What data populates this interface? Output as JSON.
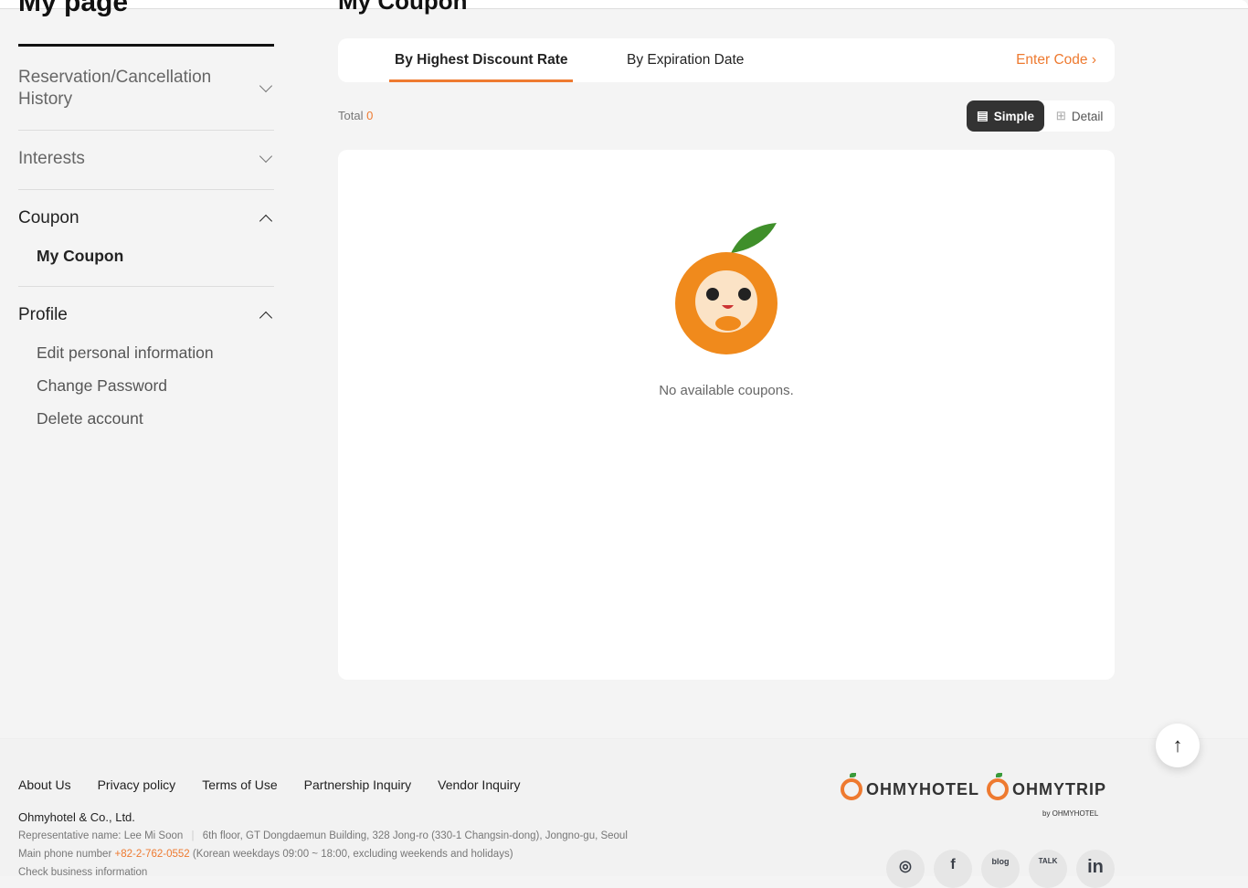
{
  "page_title": "My page",
  "main_title": "My Coupon",
  "sidebar": {
    "sections": [
      {
        "label": "Reservation/Cancellation History"
      },
      {
        "label": "Interests"
      },
      {
        "label": "Coupon",
        "items": [
          "My Coupon"
        ]
      },
      {
        "label": "Profile",
        "items": [
          "Edit personal information",
          "Change Password",
          "Delete account"
        ]
      }
    ]
  },
  "tabs": [
    "By Highest Discount Rate",
    "By Expiration Date"
  ],
  "enter_code": "Enter Code",
  "total_label": "Total",
  "total_count": "0",
  "view_toggle": {
    "simple": "Simple",
    "detail": "Detail"
  },
  "empty_message": "No available coupons.",
  "footer": {
    "links": [
      "About Us",
      "Privacy policy",
      "Terms of Use",
      "Partnership Inquiry",
      "Vendor Inquiry"
    ],
    "company": "Ohmyhotel & Co., Ltd.",
    "representative": "Representative name: Lee Mi Soon",
    "address": "6th floor, GT Dongdaemun Building, 328 Jong-ro (330-1 Changsin-dong), Jongno-gu, Seoul",
    "phone_label": "Main phone number",
    "phone": "+82-2-762-0552",
    "hours": "(Korean weekdays 09:00 ~ 18:00, excluding weekends and holidays)",
    "business_info": "Check business information",
    "logos": [
      "OHMYHOTEL",
      "OHMYTRIP"
    ],
    "byline": "by OHMYHOTEL",
    "social": [
      "instagram",
      "facebook",
      "blog",
      "kakaotalk",
      "linkedin"
    ]
  },
  "colors": {
    "accent": "#ee7a30"
  }
}
